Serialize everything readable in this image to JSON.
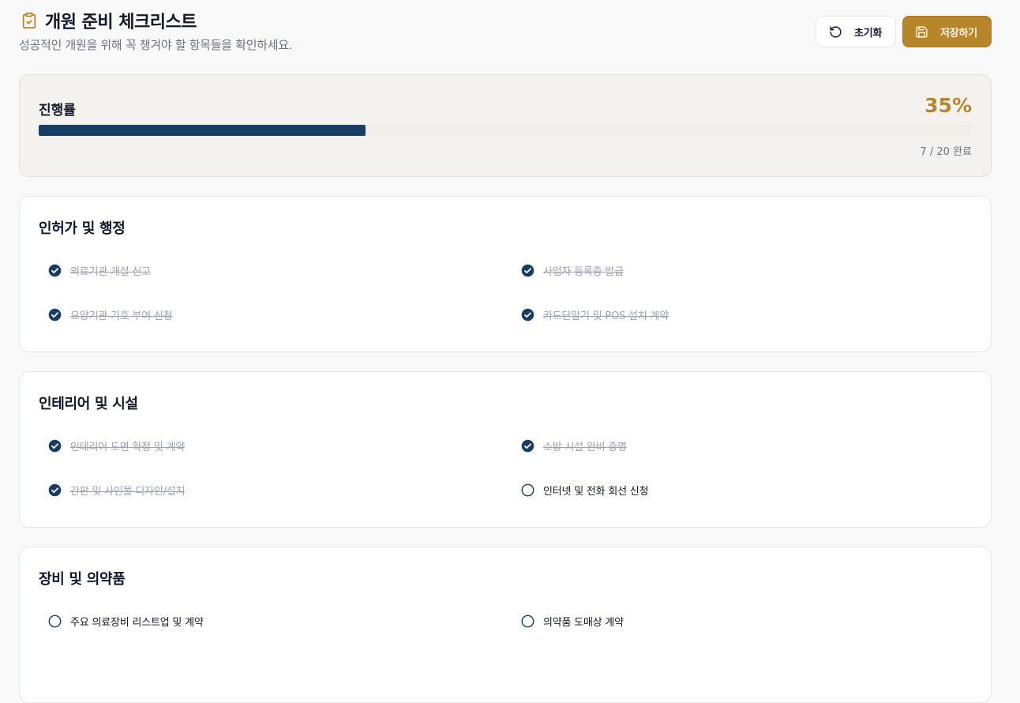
{
  "header": {
    "title": "개원 준비 체크리스트",
    "subtitle": "성공적인 개원을 위해 꼭 챙겨야 할 항목들을 확인하세요.",
    "reset_label": "초기화",
    "save_label": "저장하기"
  },
  "progress": {
    "label": "진행률",
    "percent_text": "35%",
    "percent": 35,
    "count_text": "7 / 20 완료"
  },
  "sections": [
    {
      "title": "인허가 및 행정",
      "items": [
        {
          "label": "의료기관 개설 신고",
          "done": true
        },
        {
          "label": "사업자 등록증 발급",
          "done": true
        },
        {
          "label": "요양기관 기호 부여 신청",
          "done": true
        },
        {
          "label": "카드단말기 및 POS 설치 계약",
          "done": true
        }
      ]
    },
    {
      "title": "인테리어 및 시설",
      "items": [
        {
          "label": "인테리어 도면 확정 및 계약",
          "done": true
        },
        {
          "label": "소방 시설 완비 증명",
          "done": true
        },
        {
          "label": "간판 및 사인물 디자인/설치",
          "done": true
        },
        {
          "label": "인터넷 및 전화 회선 신청",
          "done": false
        }
      ]
    },
    {
      "title": "장비 및 의약품",
      "items": [
        {
          "label": "주요 의료장비 리스트업 및 계약",
          "done": false
        },
        {
          "label": "의약품 도매상 계약",
          "done": false
        }
      ]
    }
  ],
  "colors": {
    "accent": "#b7862a",
    "progress_fill": "#173c66",
    "check_done": "#173c66"
  }
}
